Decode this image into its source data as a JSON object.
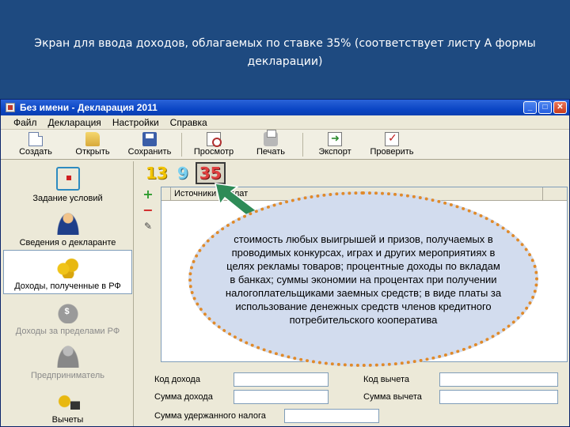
{
  "slide": {
    "title": "Экран для ввода доходов, облагаемых по ставке 35% (соответствует листу А формы декларации)"
  },
  "window": {
    "title": "Без имени - Декларация 2011",
    "buttons": {
      "minimize": "_",
      "maximize": "□",
      "close": "✕"
    }
  },
  "menu": {
    "items": [
      "Файл",
      "Декларация",
      "Настройки",
      "Справка"
    ]
  },
  "toolbar": {
    "items": [
      {
        "label": "Создать",
        "icon": "new-document-icon"
      },
      {
        "label": "Открыть",
        "icon": "open-folder-icon"
      },
      {
        "label": "Сохранить",
        "icon": "save-icon"
      },
      {
        "label": "Просмотр",
        "icon": "preview-icon"
      },
      {
        "label": "Печать",
        "icon": "print-icon"
      },
      {
        "label": "Экспорт",
        "icon": "export-icon"
      },
      {
        "label": "Проверить",
        "icon": "check-icon"
      }
    ]
  },
  "sidebar": {
    "items": [
      {
        "label": "Задание условий",
        "icon": "conditions-tree-icon",
        "active": false
      },
      {
        "label": "Сведения о декларанте",
        "icon": "person-icon",
        "active": false
      },
      {
        "label": "Доходы, полученные в РФ",
        "icon": "coins-icon",
        "active": true
      },
      {
        "label": "Доходы за пределами РФ",
        "icon": "money-bag-icon",
        "active": false
      },
      {
        "label": "Предприниматель",
        "icon": "businessman-icon",
        "active": false
      },
      {
        "label": "Вычеты",
        "icon": "deductions-icon",
        "active": false
      }
    ]
  },
  "rates": {
    "r13": "13",
    "r9": "9",
    "r35": "35"
  },
  "tools": {
    "add": "+",
    "remove": "−",
    "edit": "✎"
  },
  "table": {
    "header": "Источники выплат"
  },
  "form": {
    "income_code": "Код дохода",
    "income_sum": "Сумма дохода",
    "deduction_code": "Код вычета",
    "deduction_sum": "Сумма вычета",
    "withheld_tax": "Сумма удержанного налога"
  },
  "callout": {
    "text": "стоимость любых выигрышей и призов, получаемых в проводимых конкурсах, играх и других мероприятиях в целях рекламы товаров; процентные доходы по вкладам в банках; суммы экономии на процентах при получении налогоплательщиками заемных средств; в виде платы за использование денежных средств членов кредитного потребительского кооператива"
  },
  "colors": {
    "background": "#1e4a80",
    "callout_fill": "#d2dcee",
    "callout_border": "#e08a2a",
    "arrow": "#2e8b57"
  }
}
